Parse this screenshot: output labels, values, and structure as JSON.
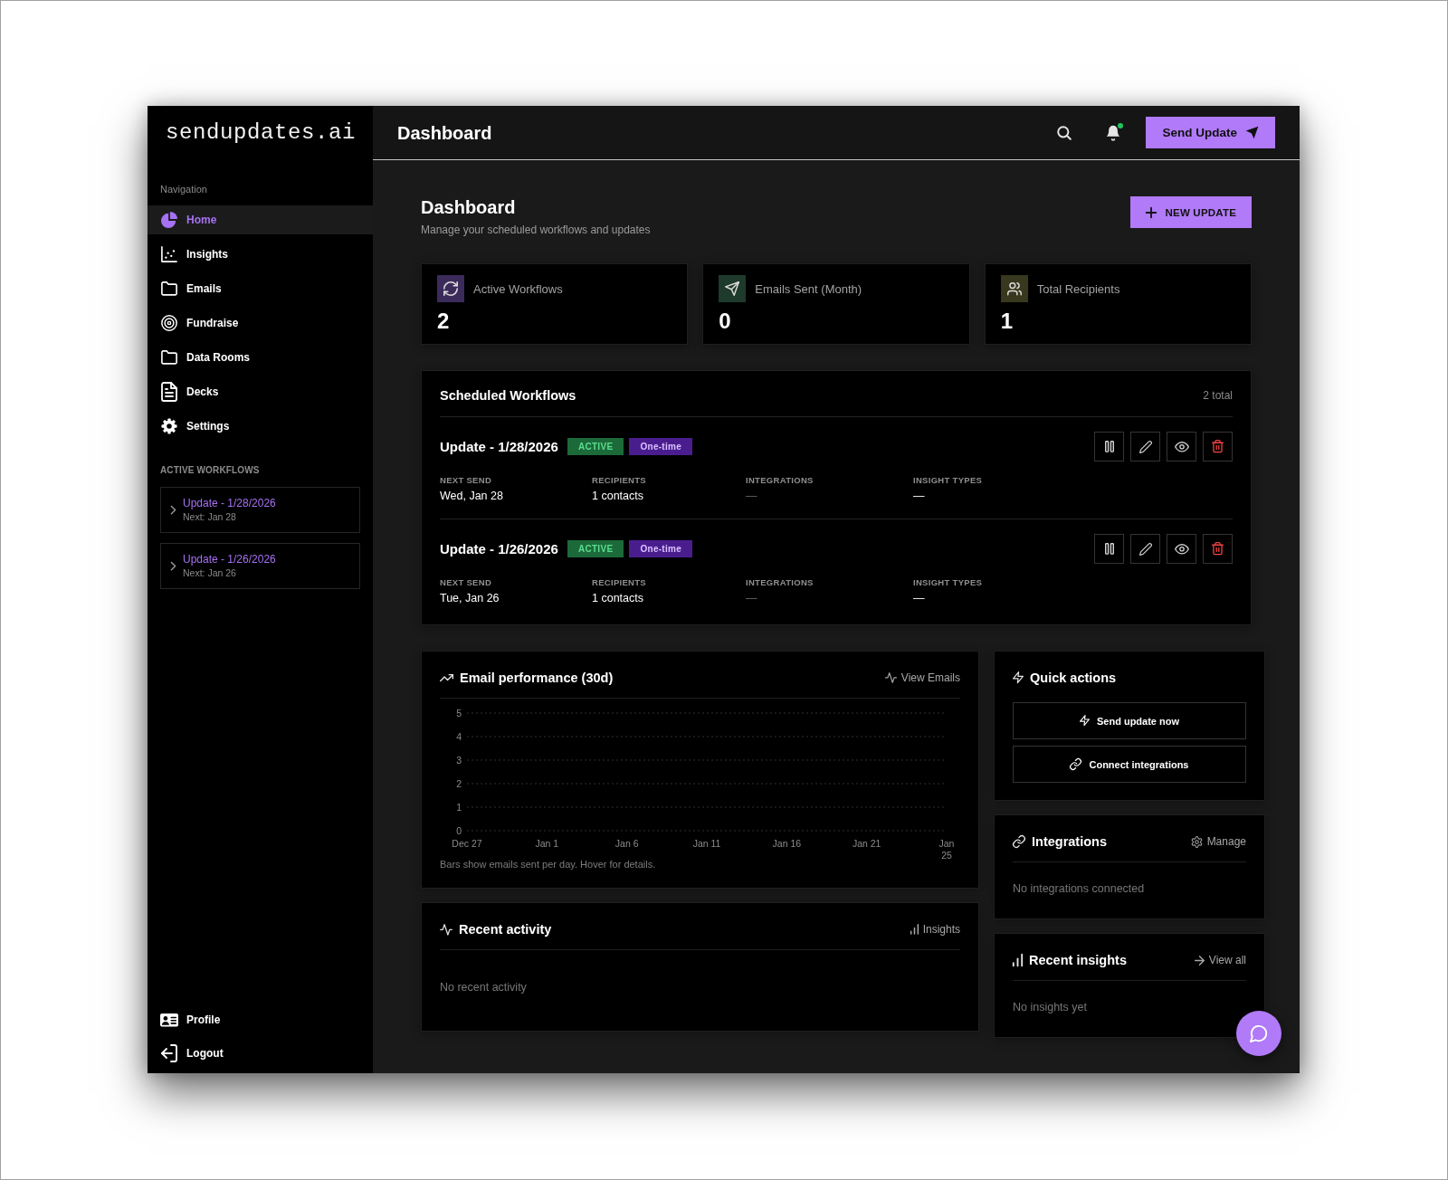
{
  "sidebar": {
    "logo": "sendupdates.ai",
    "nav_heading": "Navigation",
    "nav_items": [
      {
        "label": "Home",
        "selected": true
      },
      {
        "label": "Insights",
        "selected": false
      },
      {
        "label": "Emails",
        "selected": false
      },
      {
        "label": "Fundraise",
        "selected": false
      },
      {
        "label": "Data Rooms",
        "selected": false
      },
      {
        "label": "Decks",
        "selected": false
      },
      {
        "label": "Settings",
        "selected": false
      }
    ],
    "workflows_heading": "ACTIVE WORKFLOWS",
    "workflows": [
      {
        "title": "Update - 1/28/2026",
        "next": "Next: Jan 28"
      },
      {
        "title": "Update - 1/26/2026",
        "next": "Next: Jan 26"
      }
    ],
    "footer_items": [
      {
        "label": "Profile"
      },
      {
        "label": "Logout"
      }
    ]
  },
  "header": {
    "title": "Dashboard",
    "notification_dot": true,
    "send_button": "Send Update"
  },
  "page": {
    "title": "Dashboard",
    "subtitle": "Manage your scheduled workflows and updates",
    "new_button": "NEW UPDATE"
  },
  "stats": [
    {
      "label": "Active Workflows",
      "value": "2",
      "color": "#3b2b5b"
    },
    {
      "label": "Emails Sent (Month)",
      "value": "0",
      "color": "#1e3a2c"
    },
    {
      "label": "Total Recipients",
      "value": "1",
      "color": "#38381e"
    }
  ],
  "scheduled_workflows": {
    "title": "Scheduled Workflows",
    "count": "2 total",
    "items": [
      {
        "title": "Update - 1/28/2026",
        "badges": [
          {
            "label": "ACTIVE",
            "kind": "status"
          },
          {
            "label": "One-time",
            "kind": "frequency"
          }
        ],
        "fields": [
          {
            "label": "NEXT SEND",
            "value": "Wed, Jan 28",
            "muted": false
          },
          {
            "label": "RECIPIENTS",
            "value": "1 contacts",
            "muted": false
          },
          {
            "label": "INTEGRATIONS",
            "value": "—",
            "muted": true
          },
          {
            "label": "INSIGHT TYPES",
            "value": "—",
            "muted": false
          }
        ]
      },
      {
        "title": "Update - 1/26/2026",
        "badges": [
          {
            "label": "ACTIVE",
            "kind": "status"
          },
          {
            "label": "One-time",
            "kind": "frequency"
          }
        ],
        "fields": [
          {
            "label": "NEXT SEND",
            "value": "Tue, Jan 26",
            "muted": false
          },
          {
            "label": "RECIPIENTS",
            "value": "1 contacts",
            "muted": false
          },
          {
            "label": "INTEGRATIONS",
            "value": "—",
            "muted": true
          },
          {
            "label": "INSIGHT TYPES",
            "value": "—",
            "muted": false
          }
        ]
      }
    ]
  },
  "email_performance": {
    "title": "Email performance (30d)",
    "link": "View Emails",
    "chart_data": {
      "type": "bar",
      "categories": [
        "Dec 27",
        "Jan 1",
        "Jan 6",
        "Jan 11",
        "Jan 16",
        "Jan 21",
        "Jan 25"
      ],
      "values": [
        0,
        0,
        0,
        0,
        0,
        0,
        0
      ],
      "ylim": [
        0,
        5
      ],
      "yticks": [
        0,
        1,
        2,
        3,
        4,
        5
      ],
      "grid": true
    },
    "caption": "Bars show emails sent per day. Hover for details."
  },
  "recent_activity": {
    "title": "Recent activity",
    "link": "Insights",
    "empty_text": "No recent activity"
  },
  "quick_actions": {
    "title": "Quick actions",
    "buttons": [
      {
        "label": "Send update now"
      },
      {
        "label": "Connect integrations"
      }
    ]
  },
  "integrations": {
    "title": "Integrations",
    "link": "Manage",
    "empty_text": "No integrations connected"
  },
  "recent_insights": {
    "title": "Recent insights",
    "link": "View all",
    "empty_text": "No insights yet"
  }
}
